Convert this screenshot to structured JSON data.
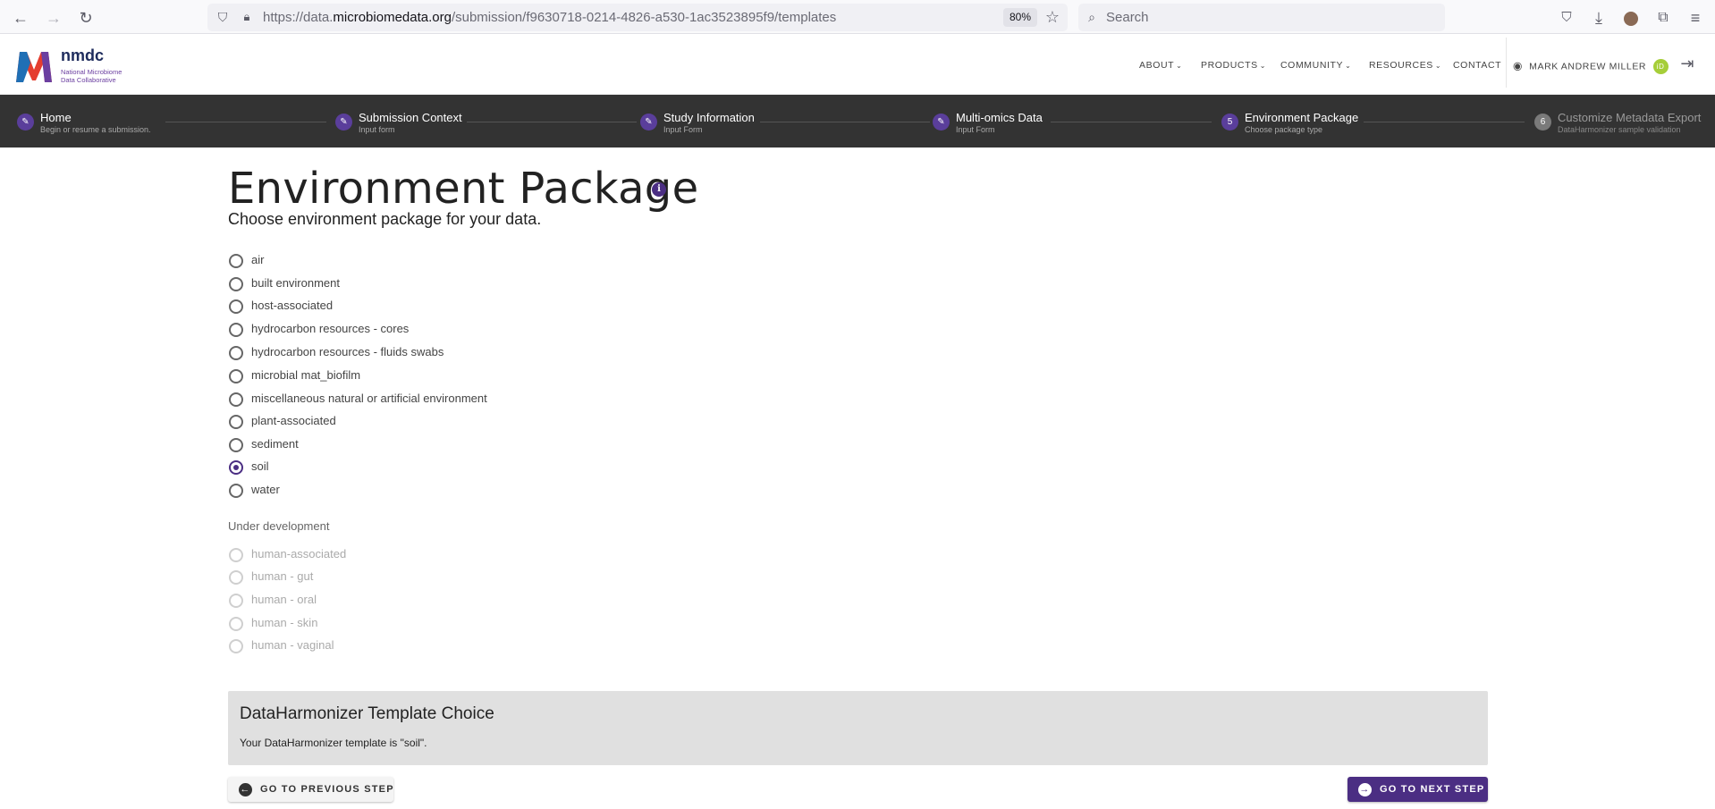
{
  "browser": {
    "url_prefix": "https://data.",
    "url_domain": "microbiomedata.org",
    "url_path": "/submission/f9630718-0214-4826-a530-1ac3523895f9/templates",
    "zoom": "80%",
    "search_placeholder": "Search"
  },
  "header": {
    "logo_name": "nmdc",
    "logo_sub": "National Microbiome Data Collaborative",
    "nav": [
      "ABOUT",
      "PRODUCTS",
      "COMMUNITY",
      "RESOURCES",
      "CONTACT"
    ],
    "user_name": "MARK ANDREW MILLER",
    "orcid_badge": "iD"
  },
  "stepper": {
    "steps": [
      {
        "title": "Home",
        "sub": "Begin or resume a submission.",
        "icon": "✎",
        "state": "done"
      },
      {
        "title": "Submission Context",
        "sub": "Input form",
        "icon": "✎",
        "state": "done"
      },
      {
        "title": "Study Information",
        "sub": "Input Form",
        "icon": "✎",
        "state": "done"
      },
      {
        "title": "Multi-omics Data",
        "sub": "Input Form",
        "icon": "✎",
        "state": "done"
      },
      {
        "title": "Environment Package",
        "sub": "Choose package type",
        "icon": "5",
        "state": "active"
      },
      {
        "title": "Customize Metadata Export",
        "sub": "DataHarmonizer sample validation",
        "icon": "6",
        "state": "pending"
      }
    ]
  },
  "main": {
    "title": "Environment Package",
    "info_icon": "i",
    "subtitle": "Choose environment package for your data.",
    "packages": [
      {
        "label": "air",
        "checked": false
      },
      {
        "label": "built environment",
        "checked": false
      },
      {
        "label": "host-associated",
        "checked": false
      },
      {
        "label": "hydrocarbon resources - cores",
        "checked": false
      },
      {
        "label": "hydrocarbon resources - fluids swabs",
        "checked": false
      },
      {
        "label": "microbial mat_biofilm",
        "checked": false
      },
      {
        "label": "miscellaneous natural or artificial environment",
        "checked": false
      },
      {
        "label": "plant-associated",
        "checked": false
      },
      {
        "label": "sediment",
        "checked": false
      },
      {
        "label": "soil",
        "checked": true
      },
      {
        "label": "water",
        "checked": false
      }
    ],
    "under_development_label": "Under development",
    "dev_packages": [
      "human-associated",
      "human - gut",
      "human - oral",
      "human - skin",
      "human - vaginal"
    ],
    "dh_title": "DataHarmonizer Template Choice",
    "dh_text": "Your DataHarmonizer template is \"soil\".",
    "prev_button": "GO TO PREVIOUS STEP",
    "next_button": "GO TO NEXT STEP"
  },
  "colors": {
    "accent": "#4b2e83",
    "stepper_bg": "#333333"
  }
}
